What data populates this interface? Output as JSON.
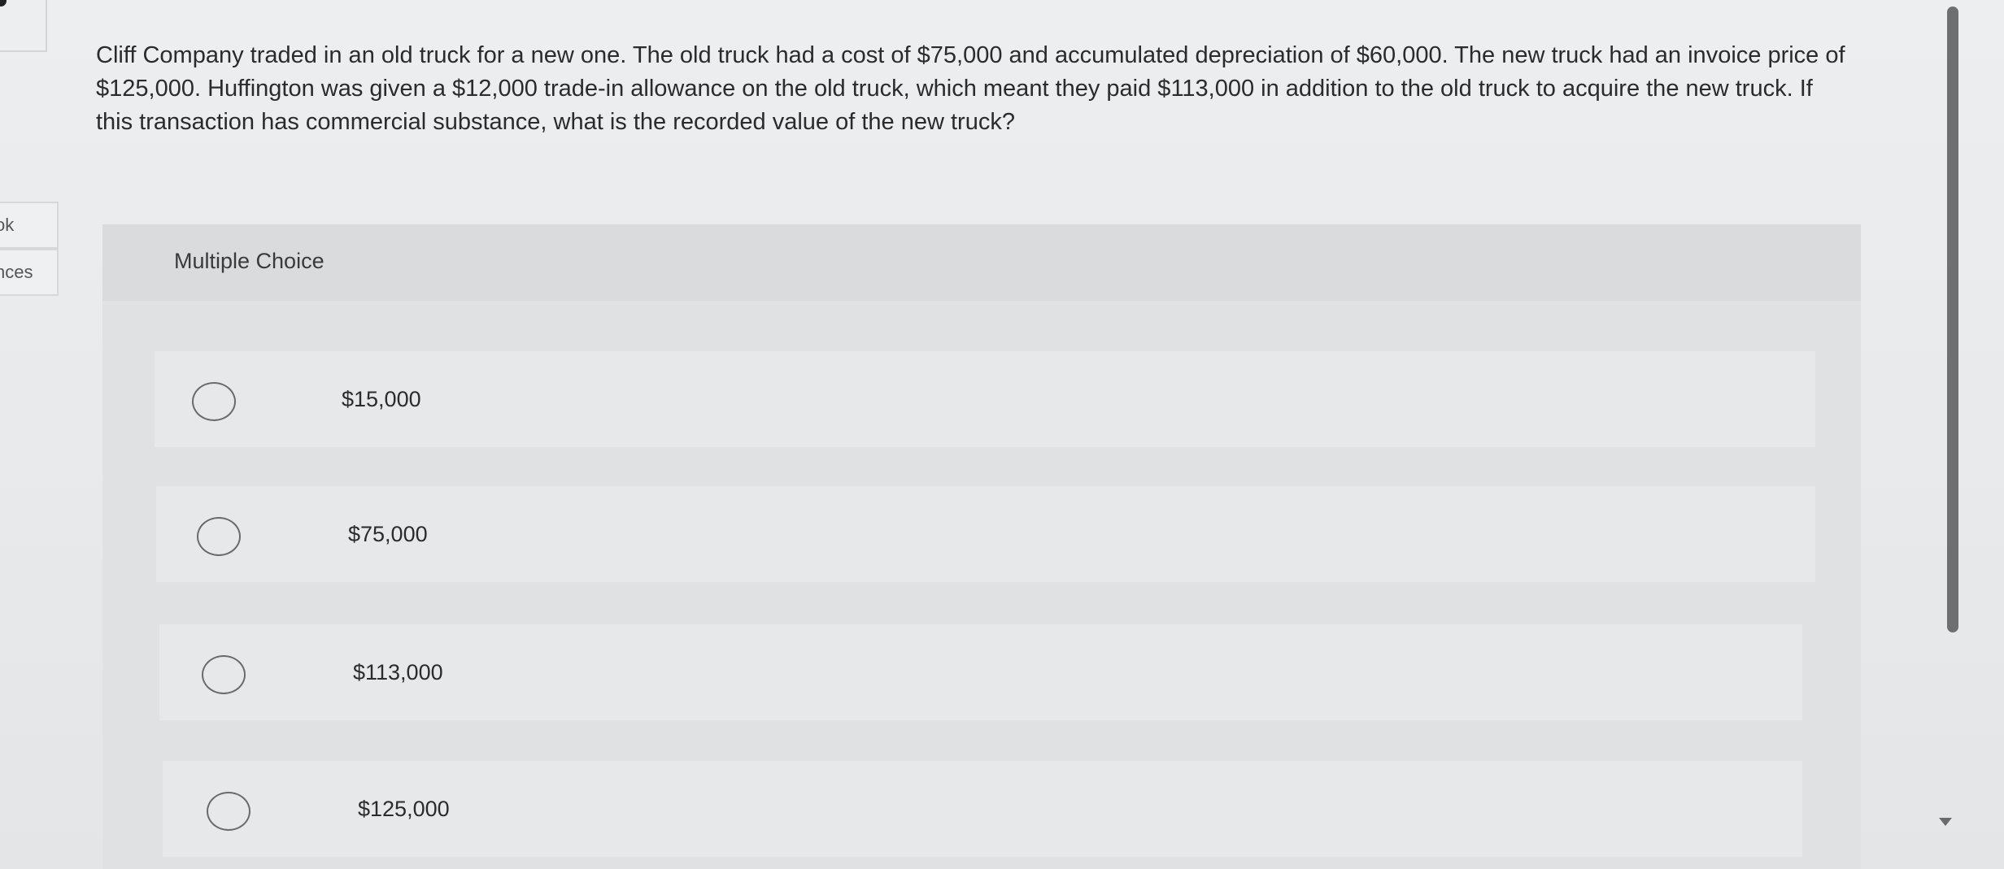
{
  "left_panel": {
    "tab_1_label": "ok",
    "tab_2_label": "nces"
  },
  "question": {
    "text": "Cliff Company traded in an old truck for a new one. The old truck had a cost of $75,000 and accumulated depreciation of $60,000. The new truck had an invoice price of $125,000. Huffington was given a $12,000 trade-in allowance on the old truck, which meant they paid $113,000 in addition to the old truck to acquire the new truck. If this transaction has commercial substance, what is the recorded value of the new truck?"
  },
  "multiple_choice": {
    "header": "Multiple Choice",
    "options": [
      {
        "label": "$15,000",
        "selected": false
      },
      {
        "label": "$75,000",
        "selected": false
      },
      {
        "label": "$113,000",
        "selected": false
      },
      {
        "label": "$125,000",
        "selected": false
      }
    ]
  },
  "icons": {
    "scroll_down": "triangle-down-icon",
    "radio": "radio-circle-icon"
  },
  "colors": {
    "page_background": "#e9ebed",
    "panel_background": "#dfe1e3",
    "header_background": "#d9dbdd",
    "option_background": "#e6e8ea",
    "scrollbar_thumb": "#6e6f71"
  }
}
